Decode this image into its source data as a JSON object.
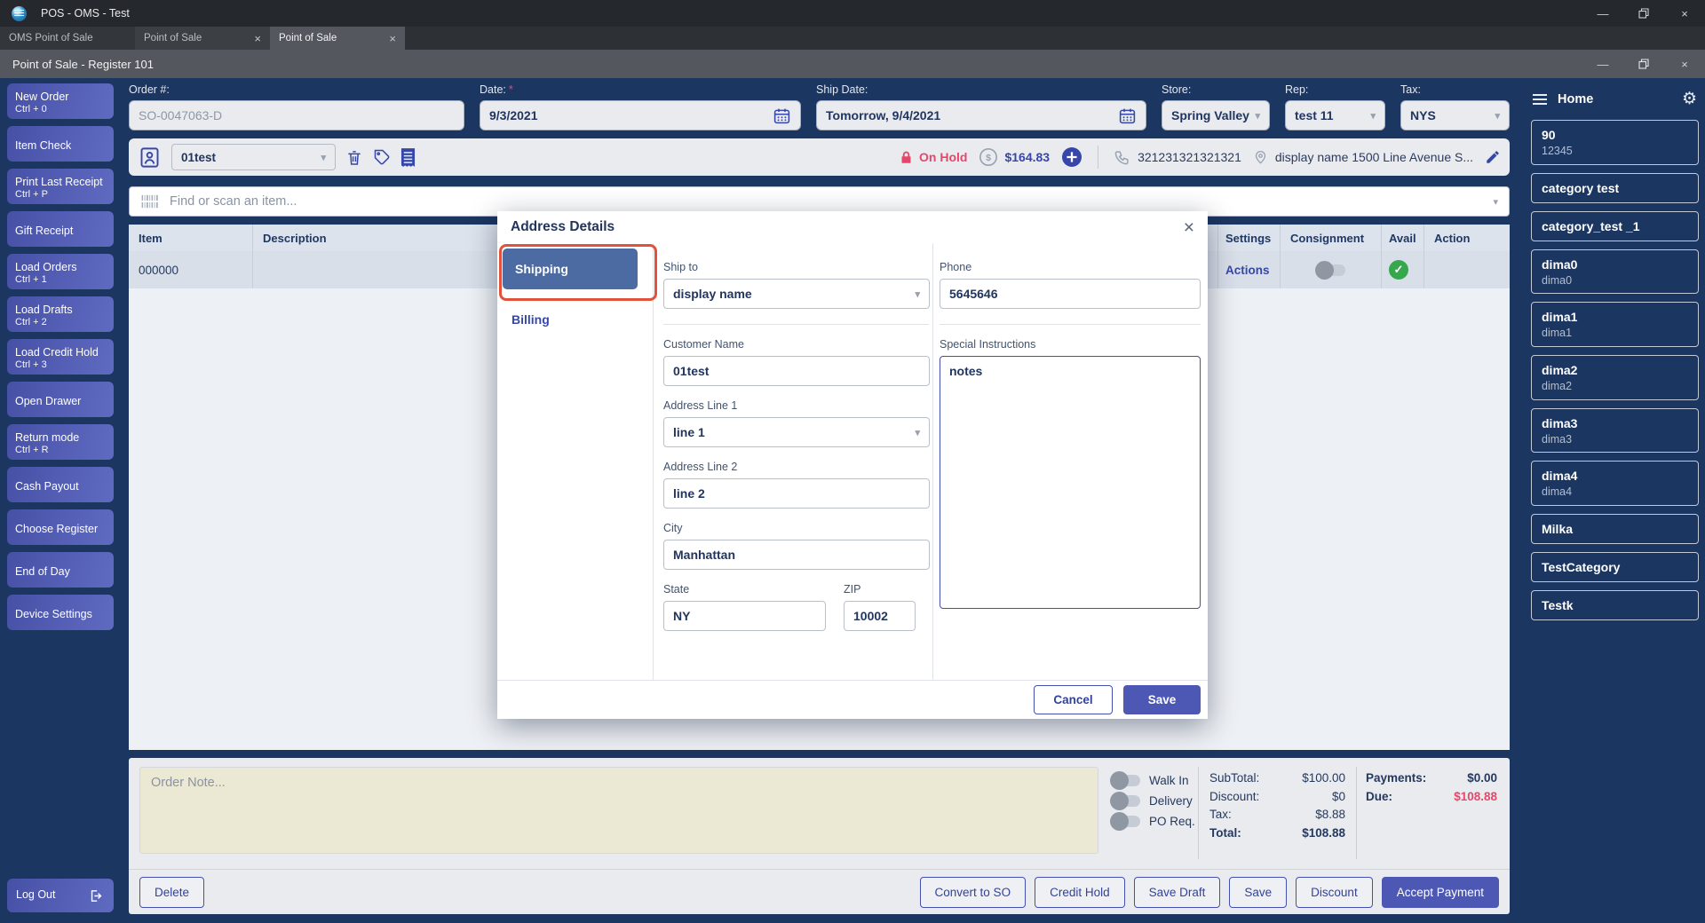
{
  "window": {
    "title": "POS - OMS - Test",
    "tabs": [
      {
        "label": "OMS Point of Sale"
      },
      {
        "label": "Point of Sale"
      },
      {
        "label": "Point of Sale"
      }
    ],
    "register_title": "Point of Sale - Register 101"
  },
  "left_sidebar": {
    "buttons": [
      {
        "label": "New Order",
        "shortcut": "Ctrl + 0"
      },
      {
        "label": "Item Check",
        "shortcut": ""
      },
      {
        "label": "Print Last Receipt",
        "shortcut": "Ctrl + P"
      },
      {
        "label": "Gift Receipt",
        "shortcut": ""
      },
      {
        "label": "Load Orders",
        "shortcut": "Ctrl + 1"
      },
      {
        "label": "Load Drafts",
        "shortcut": "Ctrl + 2"
      },
      {
        "label": "Load Credit Hold",
        "shortcut": "Ctrl + 3"
      },
      {
        "label": "Open Drawer",
        "shortcut": ""
      },
      {
        "label": "Return mode",
        "shortcut": "Ctrl + R"
      },
      {
        "label": "Cash Payout",
        "shortcut": ""
      },
      {
        "label": "Choose Register",
        "shortcut": ""
      },
      {
        "label": "End of Day",
        "shortcut": ""
      },
      {
        "label": "Device Settings",
        "shortcut": ""
      }
    ],
    "logout": "Log Out"
  },
  "order_form": {
    "order_number": {
      "label": "Order #:",
      "value": "SO-0047063-D"
    },
    "date": {
      "label": "Date:",
      "required": "*",
      "value": "9/3/2021"
    },
    "ship_date": {
      "label": "Ship Date:",
      "value": "Tomorrow, 9/4/2021"
    },
    "store": {
      "label": "Store:",
      "value": "Spring Valley"
    },
    "rep": {
      "label": "Rep:",
      "value": "test 11"
    },
    "tax": {
      "label": "Tax:",
      "value": "NYS"
    }
  },
  "toolbar": {
    "customer": "01test",
    "on_hold": "On Hold",
    "balance": "$164.83",
    "phone": "321231321321321",
    "address": "display name 1500 Line Avenue S..."
  },
  "search": {
    "placeholder": "Find or scan an item..."
  },
  "items_table": {
    "headers": {
      "item": "Item",
      "description": "Description",
      "settings": "Settings",
      "consignment": "Consignment",
      "avail": "Avail",
      "action": "Action"
    },
    "row": {
      "item": "000000",
      "settings_link": "Actions"
    }
  },
  "address_modal": {
    "title": "Address Details",
    "tabs": {
      "shipping": "Shipping",
      "billing": "Billing"
    },
    "fields": {
      "ship_to": {
        "label": "Ship to",
        "value": "display name"
      },
      "phone": {
        "label": "Phone",
        "value": "5645646"
      },
      "customer_name": {
        "label": "Customer Name",
        "value": "01test"
      },
      "address_line_1": {
        "label": "Address Line 1",
        "value": "line 1"
      },
      "address_line_2": {
        "label": "Address Line 2",
        "value": "line 2"
      },
      "city": {
        "label": "City",
        "value": "Manhattan"
      },
      "state": {
        "label": "State",
        "value": "NY"
      },
      "zip": {
        "label": "ZIP",
        "value": "10002"
      },
      "special_instructions": {
        "label": "Special Instructions",
        "value": "notes"
      }
    },
    "buttons": {
      "cancel": "Cancel",
      "save": "Save"
    }
  },
  "footer": {
    "order_note_placeholder": "Order Note...",
    "toggles": [
      {
        "label": "Walk In"
      },
      {
        "label": "Delivery"
      },
      {
        "label": "PO Req."
      }
    ],
    "totals": [
      {
        "label": "SubTotal:",
        "value": "$100.00"
      },
      {
        "label": "Discount:",
        "value": "$0"
      },
      {
        "label": "Tax:",
        "value": "$8.88"
      },
      {
        "label": "Total:",
        "value": "$108.88"
      }
    ],
    "payments": [
      {
        "label": "Payments:",
        "value": "$0.00"
      },
      {
        "label": "Due:",
        "value": "$108.88"
      }
    ],
    "actions": {
      "delete": "Delete",
      "convert_to_so": "Convert to SO",
      "credit_hold": "Credit Hold",
      "save_draft": "Save Draft",
      "save": "Save",
      "discount": "Discount",
      "accept_payment": "Accept Payment"
    }
  },
  "right_sidebar": {
    "home": "Home",
    "categories": [
      {
        "title": "90",
        "subtitle": "12345"
      },
      {
        "title": "category test",
        "subtitle": ""
      },
      {
        "title": "category_test _1",
        "subtitle": ""
      },
      {
        "title": "dima0",
        "subtitle": "dima0"
      },
      {
        "title": "dima1",
        "subtitle": "dima1"
      },
      {
        "title": "dima2",
        "subtitle": "dima2"
      },
      {
        "title": "dima3",
        "subtitle": "dima3"
      },
      {
        "title": "dima4",
        "subtitle": "dima4"
      },
      {
        "title": "Milka",
        "subtitle": ""
      },
      {
        "title": "TestCategory",
        "subtitle": ""
      },
      {
        "title": "Testk",
        "subtitle": ""
      }
    ]
  },
  "colors": {
    "accent_blue": "#3647a9",
    "button_purple": "#4d58b4",
    "hold_red": "#e5476b",
    "due_red": "#e5476b",
    "avail_green": "#35a84c",
    "annotation_red": "#e0523b",
    "shipping_tab_blue": "#4c6ba3"
  }
}
